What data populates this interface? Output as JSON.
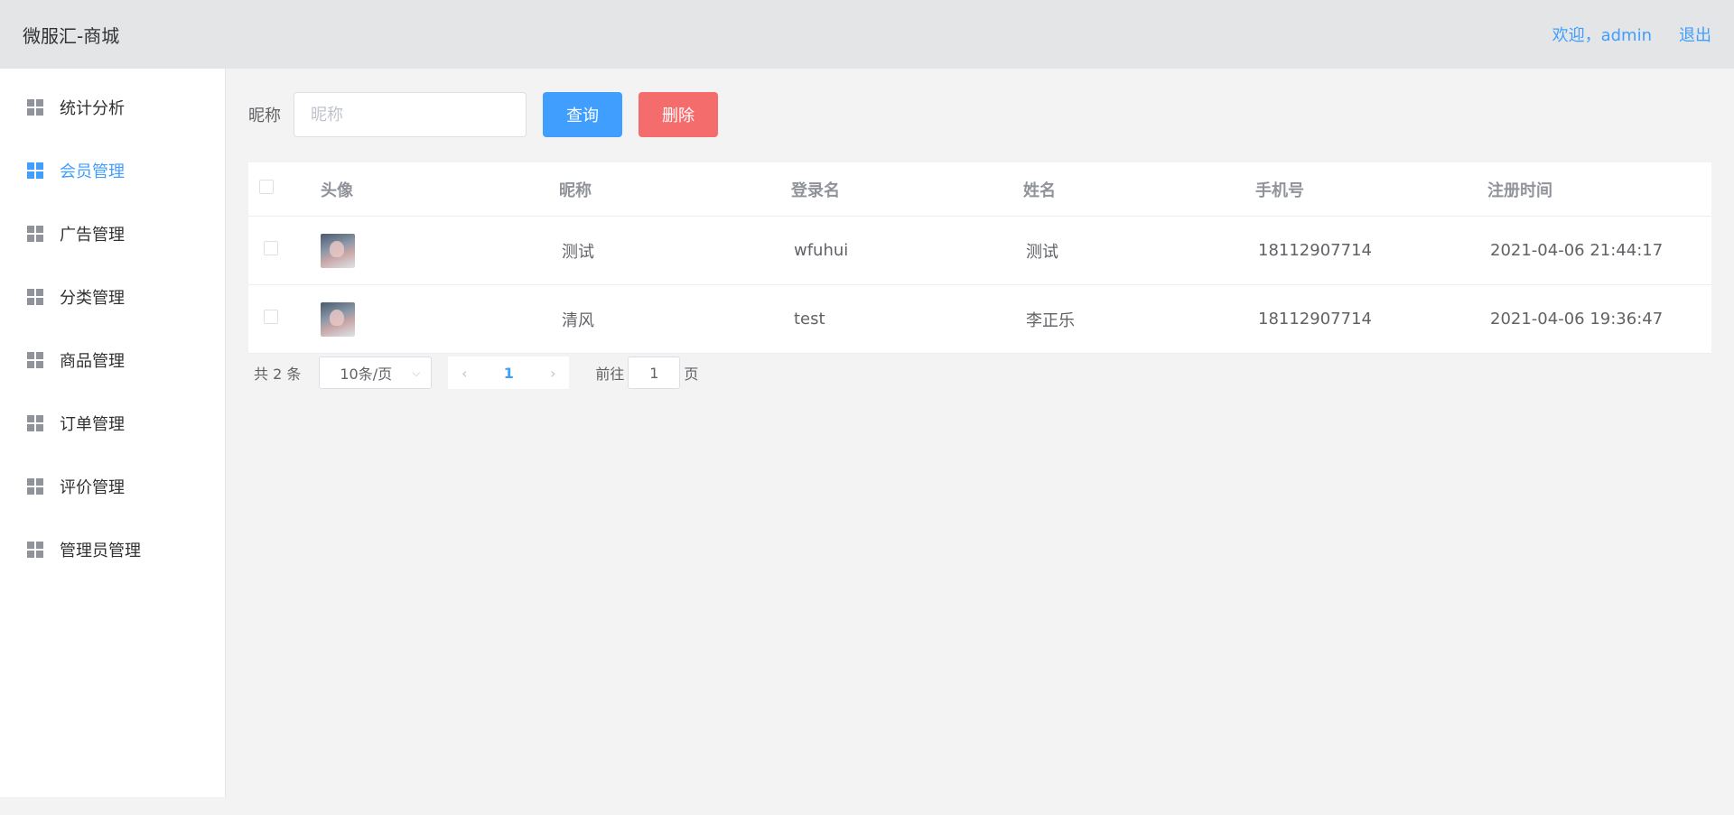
{
  "header": {
    "brand": "微服汇-商城",
    "welcome": "欢迎，admin",
    "logout": "退出"
  },
  "sidebar": {
    "items": [
      {
        "label": "统计分析",
        "icon": "grid-icon"
      },
      {
        "label": "会员管理",
        "icon": "grid-icon",
        "active": true
      },
      {
        "label": "广告管理",
        "icon": "grid-icon"
      },
      {
        "label": "分类管理",
        "icon": "grid-icon"
      },
      {
        "label": "商品管理",
        "icon": "grid-icon"
      },
      {
        "label": "订单管理",
        "icon": "grid-icon"
      },
      {
        "label": "评价管理",
        "icon": "grid-icon"
      },
      {
        "label": "管理员管理",
        "icon": "grid-icon"
      }
    ]
  },
  "search": {
    "label": "昵称",
    "placeholder": "昵称",
    "query_label": "查询",
    "delete_label": "删除"
  },
  "table": {
    "columns": [
      "头像",
      "昵称",
      "登录名",
      "姓名",
      "手机号",
      "注册时间"
    ],
    "rows": [
      {
        "nickname": "测试",
        "login": "wfuhui",
        "name": "测试",
        "phone": "18112907714",
        "registered": "2021-04-06 21:44:17"
      },
      {
        "nickname": "清风",
        "login": "test",
        "name": "李正乐",
        "phone": "18112907714",
        "registered": "2021-04-06 19:36:47"
      }
    ]
  },
  "pagination": {
    "total": "共 2 条",
    "page_size": "10条/页",
    "current_page": "1",
    "goto_prefix": "前往",
    "goto_value": "1",
    "goto_suffix": "页"
  },
  "colors": {
    "accent": "#409eff",
    "danger": "#f56c6c",
    "header_bg": "#e4e5e7"
  }
}
